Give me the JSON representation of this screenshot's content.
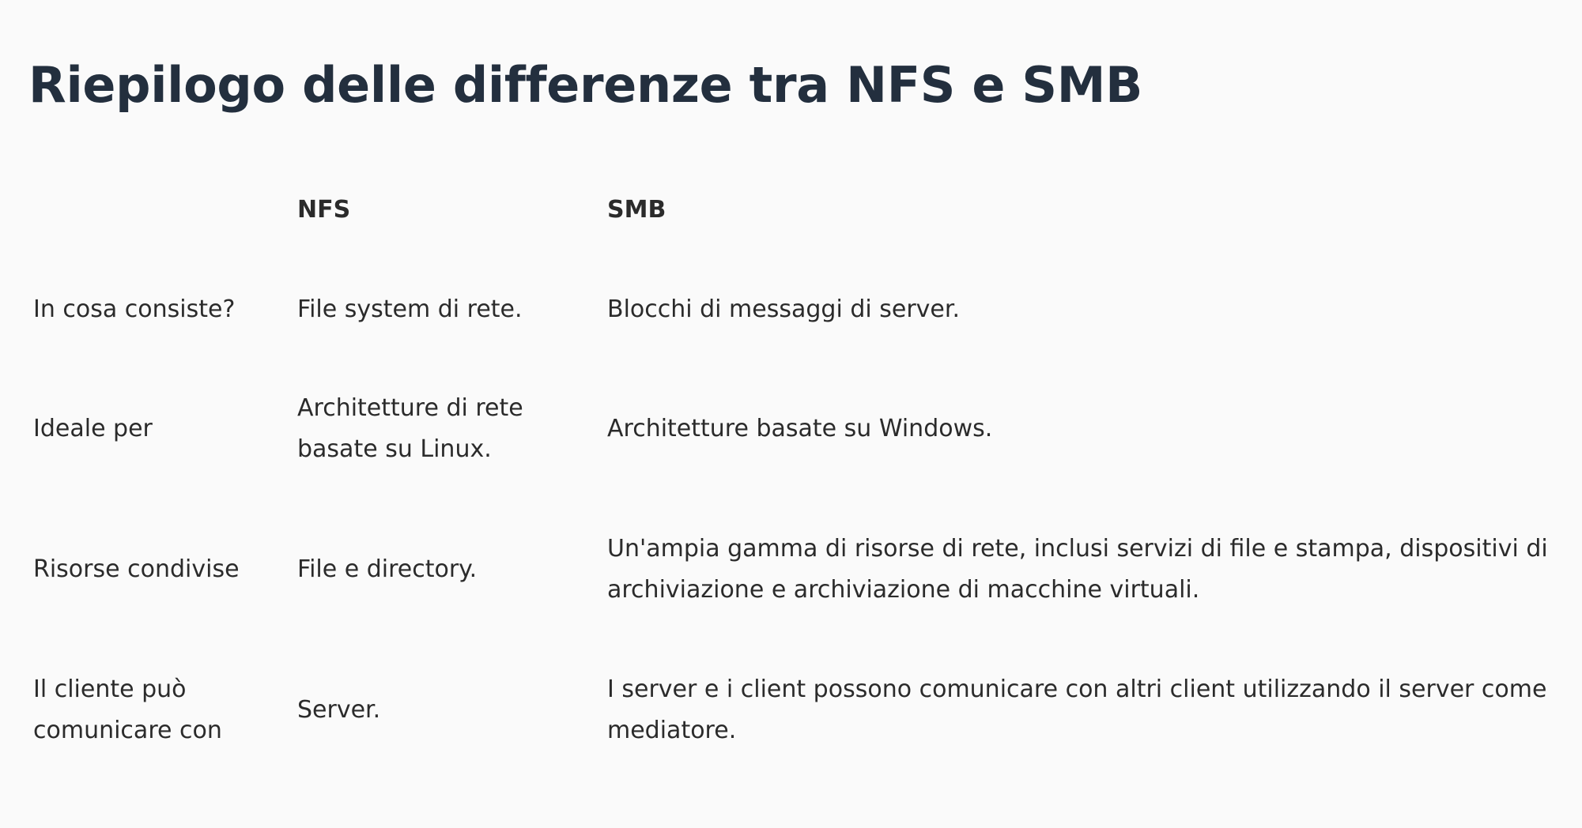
{
  "page": {
    "title": "Riepilogo delle differenze tra NFS e SMB"
  },
  "table": {
    "headers": [
      "",
      "NFS",
      "SMB"
    ],
    "rows": [
      {
        "label": "In cosa consiste?",
        "nfs": "File system di rete.",
        "smb": "Blocchi di messaggi di server."
      },
      {
        "label": "Ideale per",
        "nfs": "Architetture di rete basate su Linux.",
        "smb": "Architetture basate su Windows."
      },
      {
        "label": "Risorse condivise",
        "nfs": "File e directory.",
        "smb": "Un'ampia gamma di risorse di rete, inclusi servizi di file e stampa, dispositivi di archiviazione e archiviazione di macchine virtuali."
      },
      {
        "label": "Il cliente può comunicare con",
        "nfs": "Server.",
        "smb": "I server e i client possono comunicare con altri client utilizzando il server come mediatore."
      }
    ]
  }
}
